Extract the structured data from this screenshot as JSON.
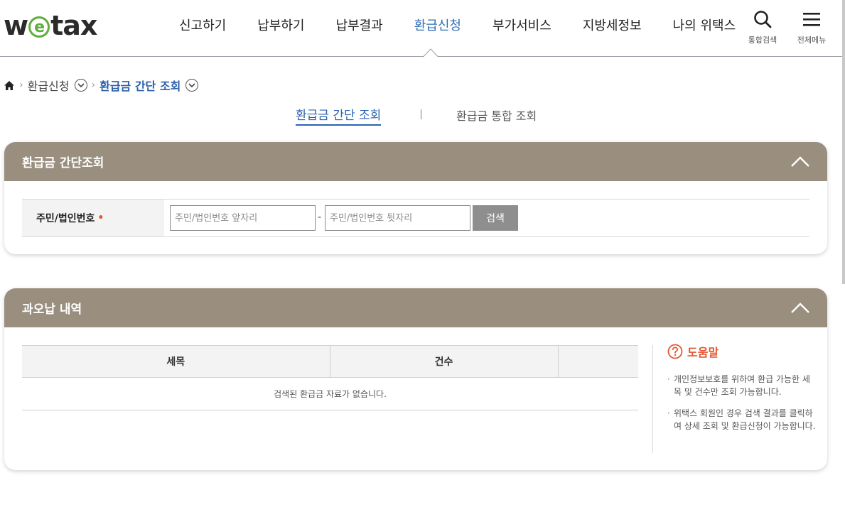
{
  "header": {
    "logo": {
      "pre": "w",
      "mid": "e",
      "post": "tax"
    },
    "nav": [
      "신고하기",
      "납부하기",
      "납부결과",
      "환급신청",
      "부가서비스",
      "지방세정보",
      "나의 위택스"
    ],
    "active_nav_index": 3,
    "search_label": "통합검색",
    "menu_label": "전체메뉴"
  },
  "breadcrumb": {
    "home_icon": "home-icon",
    "level1": "환급신청",
    "level2": "환급금 간단 조회"
  },
  "tabs": {
    "tab1": "환급금 간단 조회",
    "tab2": "환급금 통합 조회"
  },
  "panel1": {
    "title": "환급금 간단조회",
    "field_label": "주민/법인번호",
    "required_mark": "•",
    "front_placeholder": "주민/법인번호 앞자리",
    "back_placeholder": "주민/법인번호 뒷자리",
    "dash": "-",
    "search_button": "검색"
  },
  "panel2": {
    "title": "과오납 내역",
    "columns": [
      "세목",
      "건수",
      ""
    ],
    "empty_message": "검색된 환급금 자료가 없습니다.",
    "help": {
      "title": "도움말",
      "items": [
        "개인정보보호를 위하여 환급 가능한 세목 및 건수만 조회 가능합니다.",
        "위택스 회원인 경우 검색 결과를 클릭하여 상세 조회 및 환급신청이 가능합니다."
      ]
    }
  },
  "colors": {
    "accent": "#2a64b0",
    "panel_header": "#9a8f7f",
    "logo_green": "#5fae3a",
    "required": "#e4572e"
  }
}
